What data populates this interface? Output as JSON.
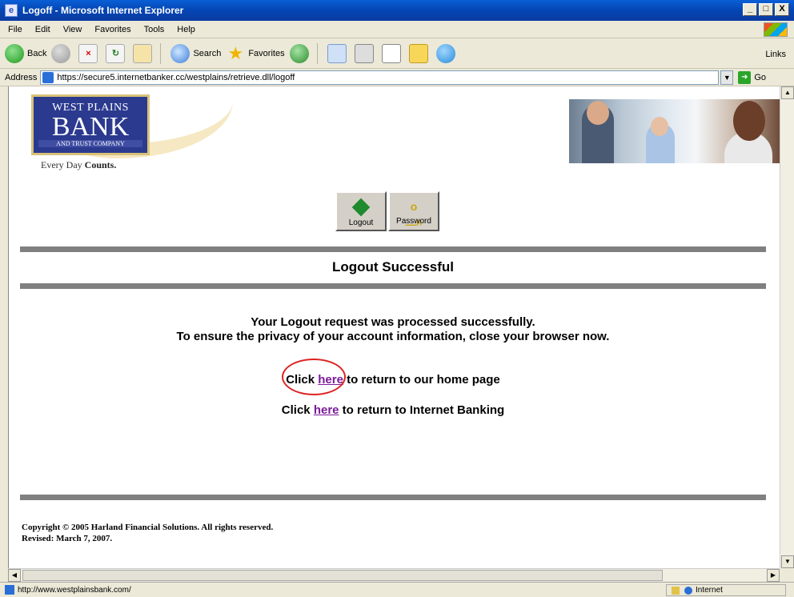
{
  "window": {
    "title": "Logoff - Microsoft Internet Explorer",
    "min": "_",
    "max": "□",
    "close": "X"
  },
  "menu": {
    "items": [
      "File",
      "Edit",
      "View",
      "Favorites",
      "Tools",
      "Help"
    ]
  },
  "toolbar": {
    "back": "Back",
    "search": "Search",
    "favorites": "Favorites",
    "links": "Links"
  },
  "address": {
    "label": "Address",
    "url": "https://secure5.internetbanker.cc/westplains/retrieve.dll/logoff",
    "go": "Go"
  },
  "page": {
    "logo": {
      "line1": "WEST PLAINS",
      "line2": "BANK",
      "line3": "AND TRUST COMPANY"
    },
    "tagline_prefix": "Every Day ",
    "tagline_bold": "Counts.",
    "buttons": {
      "logout": "Logout",
      "password": "Password"
    },
    "heading": "Logout Successful",
    "message1": "Your Logout request was processed successfully.",
    "message2": "To ensure the privacy of your account information, close your browser now.",
    "link1": {
      "pre": "Click ",
      "link": "here",
      "post": " to return to our home page"
    },
    "link2": {
      "pre": "Click ",
      "link": "here",
      "post": " to return to Internet Banking"
    },
    "copyright1": "Copyright © 2005 Harland Financial Solutions.  All rights reserved.",
    "copyright2": "Revised: March 7, 2007."
  },
  "status": {
    "url": "http://www.westplainsbank.com/",
    "zone": "Internet"
  }
}
